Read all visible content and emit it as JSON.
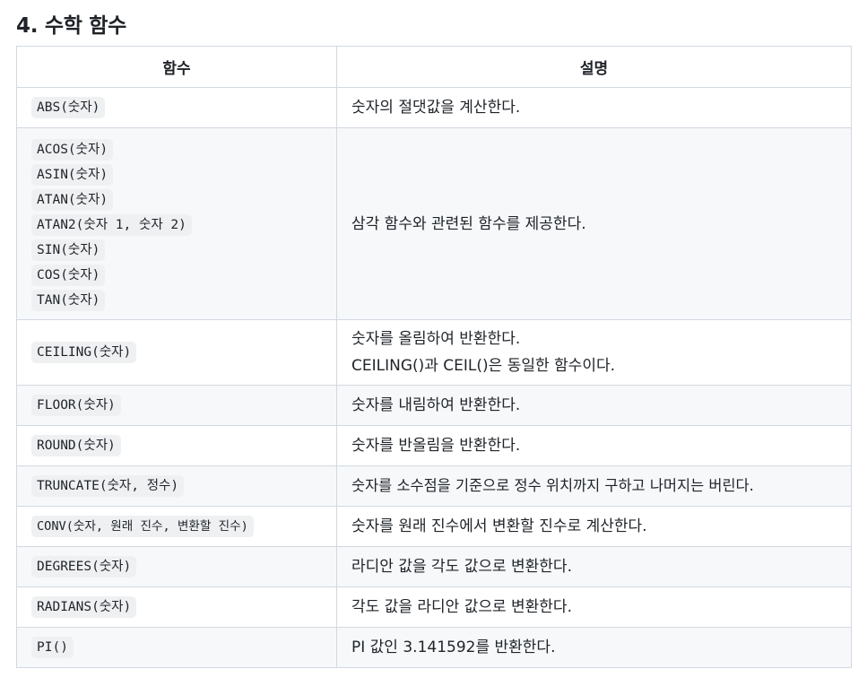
{
  "section": {
    "title": "4. 수학 함수"
  },
  "table": {
    "headers": [
      "함수",
      "설명"
    ],
    "rows": [
      {
        "functions": [
          "ABS(숫자)"
        ],
        "description": [
          "숫자의 절댓값을 계산한다."
        ]
      },
      {
        "functions": [
          "ACOS(숫자)",
          "ASIN(숫자)",
          "ATAN(숫자)",
          "ATAN2(숫자 1, 숫자 2)",
          "SIN(숫자)",
          "COS(숫자)",
          "TAN(숫자)"
        ],
        "description": [
          "삼각 함수와 관련된 함수를 제공한다."
        ]
      },
      {
        "functions": [
          "CEILING(숫자)"
        ],
        "description": [
          "숫자를 올림하여 반환한다.",
          "CEILING()과 CEIL()은 동일한 함수이다."
        ]
      },
      {
        "functions": [
          "FLOOR(숫자)"
        ],
        "description": [
          "숫자를 내림하여 반환한다."
        ]
      },
      {
        "functions": [
          "ROUND(숫자)"
        ],
        "description": [
          "숫자를 반올림을 반환한다."
        ]
      },
      {
        "functions": [
          "TRUNCATE(숫자, 정수)"
        ],
        "description": [
          "숫자를 소수점을 기준으로 정수 위치까지 구하고 나머지는 버린다."
        ]
      },
      {
        "functions": [
          "CONV(숫자, 원래 진수, 변환할 진수)"
        ],
        "description": [
          "숫자를 원래 진수에서 변환할 진수로 계산한다."
        ]
      },
      {
        "functions": [
          "DEGREES(숫자)"
        ],
        "description": [
          "라디안 값을 각도 값으로 변환한다."
        ]
      },
      {
        "functions": [
          "RADIANS(숫자)"
        ],
        "description": [
          "각도 값을 라디안 값으로 변환한다."
        ]
      },
      {
        "functions": [
          "PI()"
        ],
        "description": [
          "PI 값인 3.141592를 반환한다."
        ]
      }
    ]
  }
}
